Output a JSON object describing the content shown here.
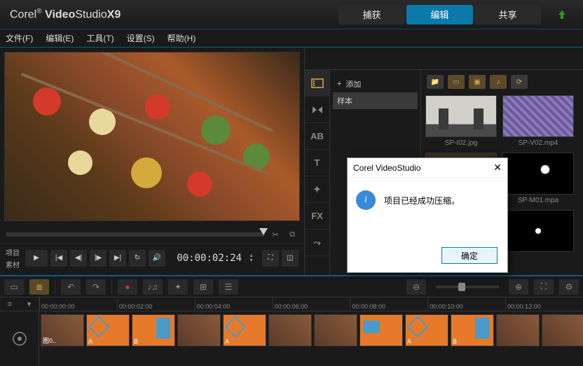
{
  "app": {
    "brand": "Corel",
    "name1": "Video",
    "name2": "Studio",
    "version": "X9"
  },
  "modes": {
    "capture": "捕获",
    "edit": "编辑",
    "share": "共享"
  },
  "menu": {
    "file": "文件(F)",
    "edit": "编辑(E)",
    "tools": "工具(T)",
    "settings": "设置(S)",
    "help": "帮助(H)"
  },
  "playback": {
    "project": "项目",
    "clip": "素材",
    "timecode": "00:00:02:24"
  },
  "library": {
    "add": "添加",
    "sample": "样本",
    "tabs": {
      "media": "媒体",
      "trans": "转场",
      "title": "AB",
      "text": "T",
      "graphic": "✦",
      "fx": "FX",
      "path": "⤳"
    },
    "thumbs": [
      "SP-I02.jpg",
      "SP-V02.mp4",
      "",
      "SP-M01.mpa",
      "",
      ""
    ]
  },
  "timeline": {
    "ticks": [
      "00:00:00:00",
      "00:00:02:00",
      "00:00:04:00",
      "00:00:06:00",
      "00:00:08:00",
      "00:00:10:00",
      "00:00:12:00"
    ],
    "clips": [
      "图0..",
      "A",
      "B",
      "",
      "A",
      "",
      "",
      "",
      "A",
      "B",
      "",
      ""
    ]
  },
  "dialog": {
    "title": "Corel VideoStudio",
    "msg": "项目已经成功压缩。",
    "ok": "确定"
  }
}
